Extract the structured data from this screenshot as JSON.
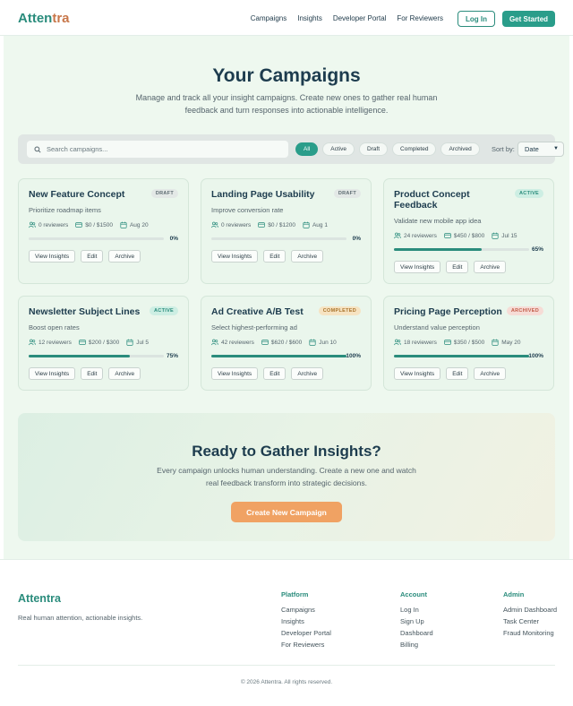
{
  "nav": {
    "brand_part1": "Atten",
    "brand_part2": "tra",
    "links": [
      "Campaigns",
      "Insights",
      "Developer Portal",
      "For Reviewers"
    ],
    "login": "Log In",
    "get_started": "Get Started"
  },
  "hero": {
    "title": "Your Campaigns",
    "subtitle": "Manage and track all your insight campaigns. Create new ones to gather real human feedback and turn responses into actionable intelligence."
  },
  "filters": {
    "search_placeholder": "Search campaigns...",
    "pills": [
      "All",
      "Active",
      "Draft",
      "Completed",
      "Archived"
    ],
    "selected_pill": "All",
    "sort_label": "Sort by:",
    "sort_value": "Date"
  },
  "card_actions": {
    "view": "View Insights",
    "edit": "Edit",
    "archive": "Archive"
  },
  "campaigns": [
    {
      "title": "New Feature Concept",
      "status": "DRAFT",
      "description": "Prioritize roadmap items",
      "reviewers": "0 reviewers",
      "budget": "$0 / $1500",
      "date": "Aug 20",
      "progress": 0,
      "progress_label": "0%"
    },
    {
      "title": "Landing Page Usability",
      "status": "DRAFT",
      "description": "Improve conversion rate",
      "reviewers": "0 reviewers",
      "budget": "$0 / $1200",
      "date": "Aug 1",
      "progress": 0,
      "progress_label": "0%"
    },
    {
      "title": "Product Concept Feedback",
      "status": "ACTIVE",
      "description": "Validate new mobile app idea",
      "reviewers": "24 reviewers",
      "budget": "$450 / $800",
      "date": "Jul 15",
      "progress": 65,
      "progress_label": "65%"
    },
    {
      "title": "Newsletter Subject Lines",
      "status": "ACTIVE",
      "description": "Boost open rates",
      "reviewers": "12 reviewers",
      "budget": "$200 / $300",
      "date": "Jul 5",
      "progress": 75,
      "progress_label": "75%"
    },
    {
      "title": "Ad Creative A/B Test",
      "status": "COMPLETED",
      "description": "Select highest-performing ad",
      "reviewers": "42 reviewers",
      "budget": "$620 / $600",
      "date": "Jun 10",
      "progress": 100,
      "progress_label": "100%"
    },
    {
      "title": "Pricing Page Perception",
      "status": "ARCHIVED",
      "description": "Understand value perception",
      "reviewers": "18 reviewers",
      "budget": "$350 / $500",
      "date": "May 20",
      "progress": 100,
      "progress_label": "100%"
    }
  ],
  "cta": {
    "title": "Ready to Gather Insights?",
    "subtitle": "Every campaign unlocks human understanding. Create a new one and watch real feedback transform into strategic decisions.",
    "button": "Create New Campaign"
  },
  "footer": {
    "brand": "Attentra",
    "tagline": "Real human attention, actionable insights.",
    "columns": [
      {
        "heading": "Platform",
        "links": [
          "Campaigns",
          "Insights",
          "Developer Portal",
          "For Reviewers"
        ]
      },
      {
        "heading": "Account",
        "links": [
          "Log In",
          "Sign Up",
          "Dashboard",
          "Billing"
        ]
      },
      {
        "heading": "Admin",
        "links": [
          "Admin Dashboard",
          "Task Center",
          "Fraud Monitoring"
        ]
      }
    ],
    "copyright": "© 2026 Attentra. All rights reserved."
  },
  "icons": {
    "reviewers": "users-icon",
    "budget": "card-icon",
    "date": "calendar-icon",
    "search": "search-icon"
  },
  "colors": {
    "primary": "#2a9d8a",
    "accent": "#f0a263",
    "brand_secondary": "#c8774a"
  }
}
